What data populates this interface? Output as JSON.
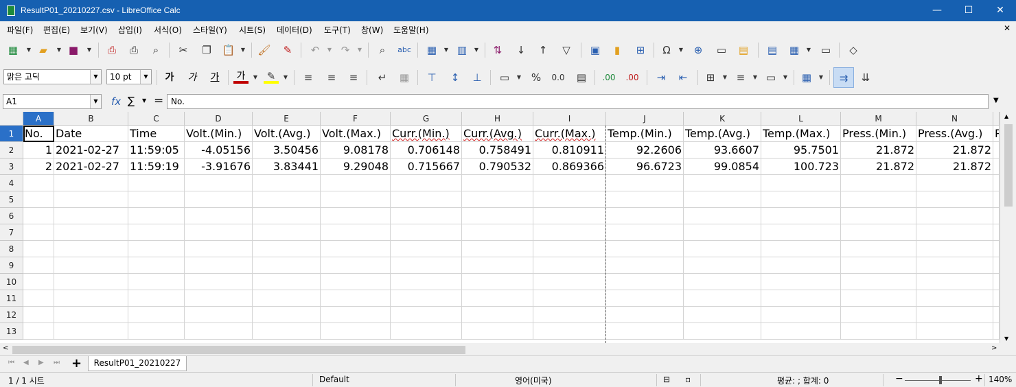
{
  "window": {
    "title": "ResultP01_20210227.csv - LibreOffice Calc",
    "minimize": "—",
    "maximize": "☐",
    "close": "✕"
  },
  "menu": [
    "파일(F)",
    "편집(E)",
    "보기(V)",
    "삽입(I)",
    "서식(O)",
    "스타일(Y)",
    "시트(S)",
    "데이터(D)",
    "도구(T)",
    "창(W)",
    "도움말(H)"
  ],
  "formatting": {
    "font_name": "맑은 고딕",
    "font_size": "10 pt",
    "bold": "가",
    "italic": "가",
    "underline": "가",
    "font_color_glyph": "가",
    "font_color": "#c00000",
    "highlight_color": "#ffff00",
    "percent": "%",
    "decimal": "0.0",
    "add_decimal": ".00",
    "del_decimal": ".00"
  },
  "formula_bar": {
    "name_box": "A1",
    "fx": "fx",
    "sum": "∑",
    "equals": "=",
    "content": "No."
  },
  "columns": [
    "A",
    "B",
    "C",
    "D",
    "E",
    "F",
    "G",
    "H",
    "I",
    "J",
    "K",
    "L",
    "M",
    "N",
    ""
  ],
  "rows": [
    "1",
    "2",
    "3",
    "4",
    "5",
    "6",
    "7",
    "8",
    "9",
    "10",
    "11",
    "12",
    "13"
  ],
  "sheet": {
    "header": [
      "No.",
      "Date",
      "Time",
      "Volt.(Min.)",
      "Volt.(Avg.)",
      "Volt.(Max.)",
      "Curr.(Min.)",
      "Curr.(Avg.)",
      "Curr.(Max.)",
      "Temp.(Min.)",
      "Temp.(Avg.)",
      "Temp.(Max.)",
      "Press.(Min.)",
      "Press.(Avg.)",
      "P"
    ],
    "rows": [
      [
        "1",
        "2021-02-27",
        "11:59:05",
        "-4.05156",
        "3.50456",
        "9.08178",
        "0.706148",
        "0.758491",
        "0.810911",
        "92.2606",
        "93.6607",
        "95.7501",
        "21.872",
        "21.872",
        ""
      ],
      [
        "2",
        "2021-02-27",
        "11:59:19",
        "-3.91676",
        "3.83441",
        "9.29048",
        "0.715667",
        "0.790532",
        "0.869366",
        "96.6723",
        "99.0854",
        "100.723",
        "21.872",
        "21.872",
        ""
      ]
    ]
  },
  "tabs": {
    "add": "+",
    "sheet_name": "ResultP01_20210227"
  },
  "status": {
    "sheet_pos": "1 / 1 시트",
    "page_style": "Default",
    "language": "영어(미국)",
    "summary": "평균: ; 합계: 0",
    "zoom_minus": "−",
    "zoom_plus": "+",
    "zoom": "140%"
  }
}
